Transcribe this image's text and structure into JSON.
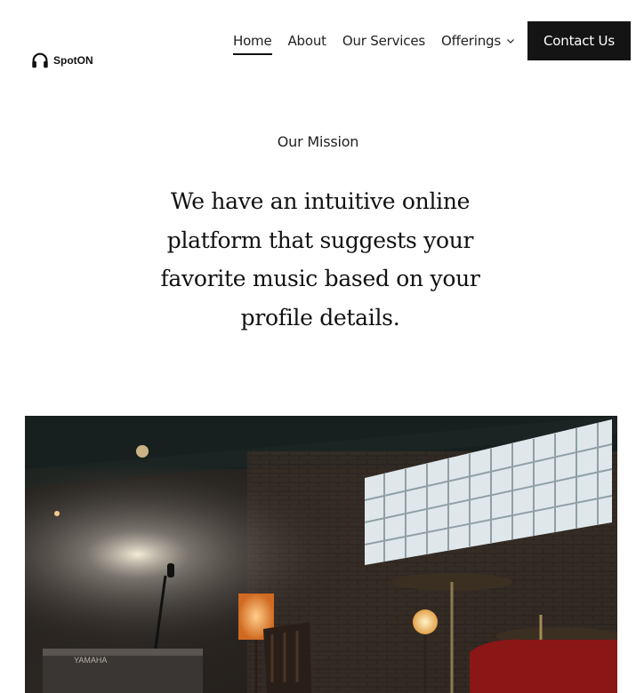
{
  "brand": {
    "name": "SpotON",
    "logo_icon": "headphones-icon"
  },
  "nav": {
    "items": [
      {
        "label": "Home",
        "active": true
      },
      {
        "label": "About",
        "active": false
      },
      {
        "label": "Our Services",
        "active": false
      },
      {
        "label": "Offerings",
        "active": false,
        "dropdown": true
      }
    ],
    "cta_label": "Contact Us"
  },
  "section": {
    "eyebrow": "Our Mission",
    "statement": "We have an intuitive online platform that suggests your favorite music based on your profile details."
  },
  "hero_image": {
    "description_icon": "music-studio-photo",
    "piano_brand": "YAMAHA"
  },
  "colors": {
    "text": "#111111",
    "cta_bg": "#141414",
    "cta_text": "#ffffff",
    "background": "#ffffff"
  }
}
